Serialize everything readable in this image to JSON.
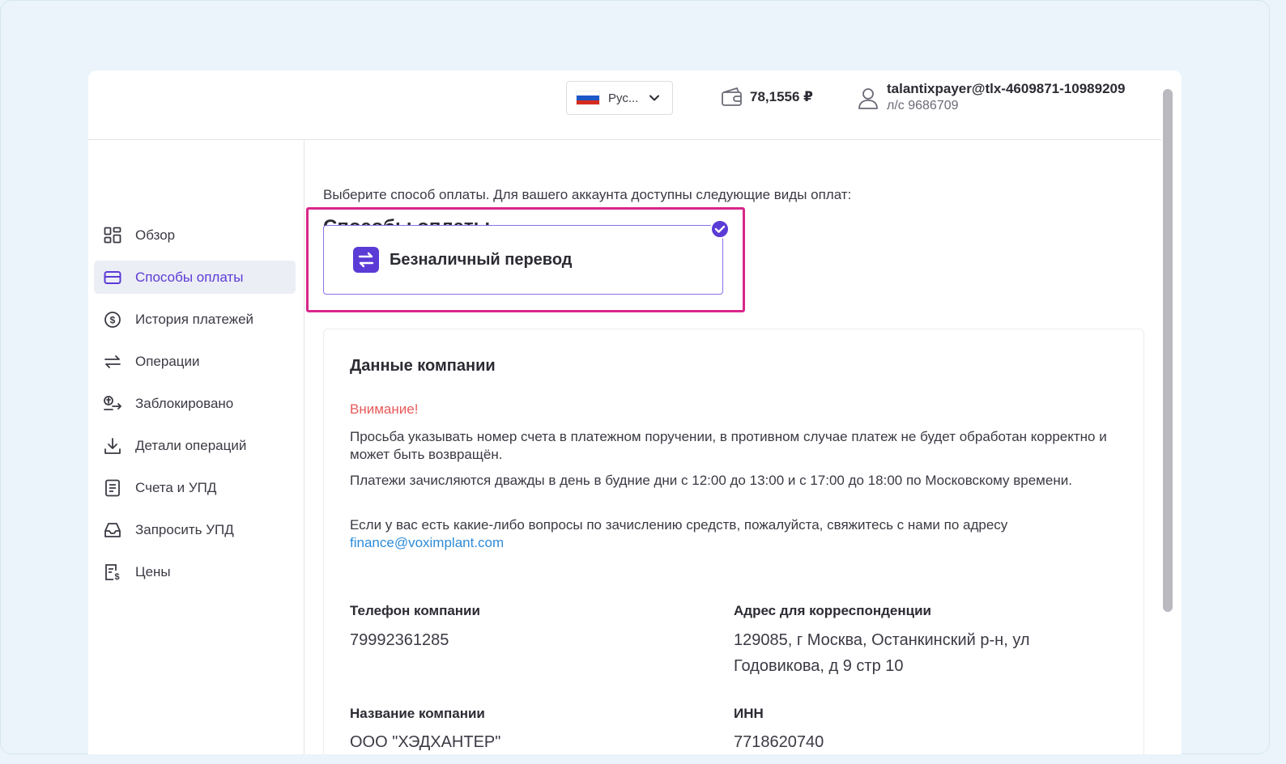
{
  "header": {
    "language": {
      "label": "Рус...",
      "flag": "ru"
    },
    "balance": "78,1556 ₽",
    "user": {
      "email": "talantixpayer@tlx-4609871-10989209",
      "account": "л/с 9686709"
    }
  },
  "sidebar": {
    "items": [
      {
        "label": "Обзор",
        "icon": "dashboard-icon"
      },
      {
        "label": "Способы оплаты",
        "icon": "card-icon",
        "active": true
      },
      {
        "label": "История платежей",
        "icon": "dollar-circle-icon"
      },
      {
        "label": "Операции",
        "icon": "swap-arrows-icon"
      },
      {
        "label": "Заблокировано",
        "icon": "blocked-funds-icon"
      },
      {
        "label": "Детали операций",
        "icon": "download-icon"
      },
      {
        "label": "Счета и УПД",
        "icon": "invoice-icon"
      },
      {
        "label": "Запросить УПД",
        "icon": "inbox-request-icon"
      },
      {
        "label": "Цены",
        "icon": "price-list-icon"
      }
    ]
  },
  "main": {
    "title": "Способы оплаты",
    "subtitle": "Выберите способ оплаты. Для вашего аккаунта доступны следующие виды оплат:",
    "payment_method": {
      "label": "Безналичный перевод",
      "selected": true
    }
  },
  "company": {
    "title": "Данные компании",
    "warning": "Внимание!",
    "para1": "Просьба указывать номер счета в платежном поручении, в противном случае платеж не будет обработан корректно и может быть возвращён.",
    "para2": "Платежи зачисляются дважды в день в будние дни с 12:00 до 13:00 и с 17:00 до 18:00 по Московскому времени.",
    "para3": "Если у вас есть какие-либо вопросы по зачислению средств, пожалуйста, свяжитесь с нами по адресу",
    "email": "finance@voximplant.com",
    "phone_label": "Телефон компании",
    "phone": "79992361285",
    "address_label": "Адрес для корреспонденции",
    "address": "129085, г Москва, Останкинский р-н, ул Годовикова, д 9 стр 10",
    "name_label": "Название компании",
    "name": "ООО \"ХЭДХАНТЕР\"",
    "inn_label": "ИНН",
    "inn": "7718620740"
  },
  "colors": {
    "accent": "#5b3bd6",
    "highlight": "#d8268b",
    "warning": "#e85a5a",
    "link": "#2e8bd8"
  }
}
